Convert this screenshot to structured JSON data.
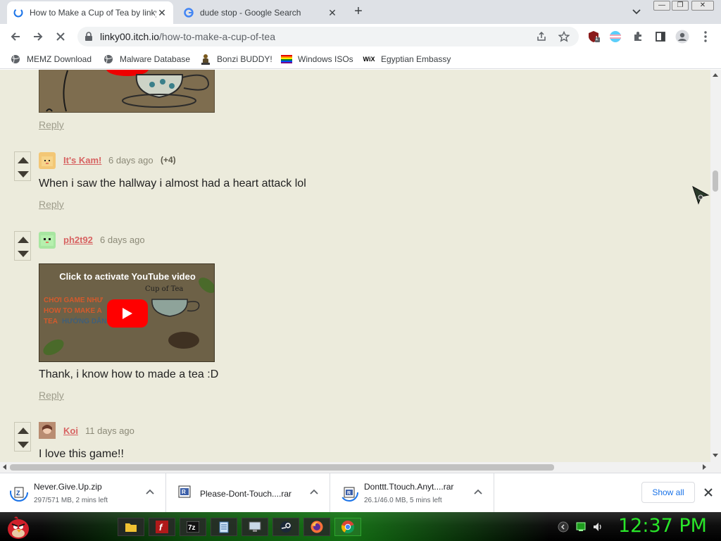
{
  "tabs": [
    {
      "title": "How to Make a Cup of Tea by linky00",
      "active": true
    },
    {
      "title": "dude stop - Google Search",
      "active": false
    }
  ],
  "address": {
    "domain": "linky00.itch.io",
    "path": "/how-to-make-a-cup-of-tea"
  },
  "toolbar": {
    "extension_badge": "1"
  },
  "bookmarks": [
    {
      "label": "MEMZ Download",
      "icon": "globe-icon"
    },
    {
      "label": "Malware Database",
      "icon": "globe-icon"
    },
    {
      "label": "Bonzi BUDDY!",
      "icon": "bonzi-icon"
    },
    {
      "label": "Windows ISOs",
      "icon": "rainbow-flag-icon"
    },
    {
      "label": "Egyptian Embassy",
      "icon": "wix-icon"
    }
  ],
  "comments": [
    {
      "reply": "Reply"
    },
    {
      "user": "It's Kam!",
      "time": "6 days ago",
      "score": "(+4)",
      "body": "When i saw the hallway i almost had a heart attack lol",
      "reply": "Reply"
    },
    {
      "user": "ph2t92",
      "time": "6 days ago",
      "body": "Thank, i know how to made a tea :D",
      "reply": "Reply",
      "video": {
        "label": "Click to activate YouTube video",
        "line1": "CHƠI GAME NHƯ",
        "line2": "HOW TO MAKE A",
        "line3": "TEA",
        "line3b": "HƯỚNG DẪN",
        "caption": "Cup of Tea"
      }
    },
    {
      "user": "Koi",
      "time": "11 days ago",
      "body": "I love this game!!"
    }
  ],
  "downloads": [
    {
      "name": "Never.Give.Up.zip",
      "status": "297/571 MB, 2 mins left"
    },
    {
      "name": "Please-Dont-Touch....rar",
      "status": ""
    },
    {
      "name": "Donttt.Ttouch.Anyt....rar",
      "status": "26.1/46.0 MB, 5 mins left"
    }
  ],
  "shelf": {
    "show_all": "Show all"
  },
  "taskbar": {
    "clock": "12:37 PM"
  },
  "colors": {
    "page_bg": "#ecebdc",
    "username": "#d76362",
    "clock": "#29e629"
  }
}
